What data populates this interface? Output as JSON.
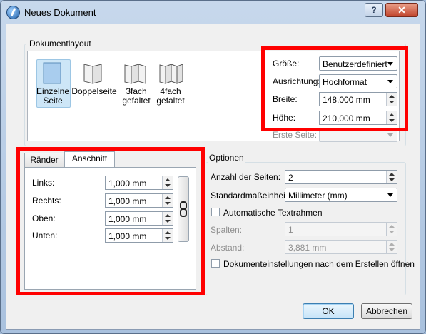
{
  "window": {
    "title": "Neues Dokument",
    "help_label": "?",
    "close_label": "✕"
  },
  "layout_group": {
    "title": "Dokumentlayout",
    "items": [
      {
        "label_line1": "Einzelne",
        "label_line2": "Seite",
        "icon": "single-page-icon",
        "selected": true
      },
      {
        "label_line1": "Doppelseite",
        "label_line2": "",
        "icon": "double-page-icon",
        "selected": false
      },
      {
        "label_line1": "3fach",
        "label_line2": "gefaltet",
        "icon": "tri-fold-icon",
        "selected": false
      },
      {
        "label_line1": "4fach",
        "label_line2": "gefaltet",
        "icon": "quad-fold-icon",
        "selected": false
      }
    ]
  },
  "page_settings": {
    "size_label": "Größe:",
    "size_value": "Benutzerdefiniert",
    "orientation_label": "Ausrichtung:",
    "orientation_value": "Hochformat",
    "width_label": "Breite:",
    "width_value": "148,000 mm",
    "height_label": "Höhe:",
    "height_value": "210,000 mm",
    "first_page_label": "Erste Seite:",
    "first_page_value": ""
  },
  "margins": {
    "tabs": [
      "Ränder",
      "Anschnitt"
    ],
    "active_tab": "Anschnitt",
    "left_label": "Links:",
    "left_value": "1,000 mm",
    "right_label": "Rechts:",
    "right_value": "1,000 mm",
    "top_label": "Oben:",
    "top_value": "1,000 mm",
    "bottom_label": "Unten:",
    "bottom_value": "1,000 mm"
  },
  "options": {
    "title": "Optionen",
    "pages_label": "Anzahl der Seiten:",
    "pages_value": "2",
    "unit_label": "Standardmaßeinheit:",
    "unit_value": "Millimeter (mm)",
    "auto_frames_label": "Automatische Textrahmen",
    "columns_label": "Spalten:",
    "columns_value": "1",
    "gap_label": "Abstand:",
    "gap_value": "3,881 mm",
    "open_settings_label": "Dokumenteinstellungen nach dem Erstellen öffnen"
  },
  "buttons": {
    "ok": "OK",
    "cancel": "Abbrechen"
  },
  "colors": {
    "highlight": "#ff0000",
    "selected_item": "#cde6f7",
    "page_icon_fill": "#a9cdee"
  }
}
